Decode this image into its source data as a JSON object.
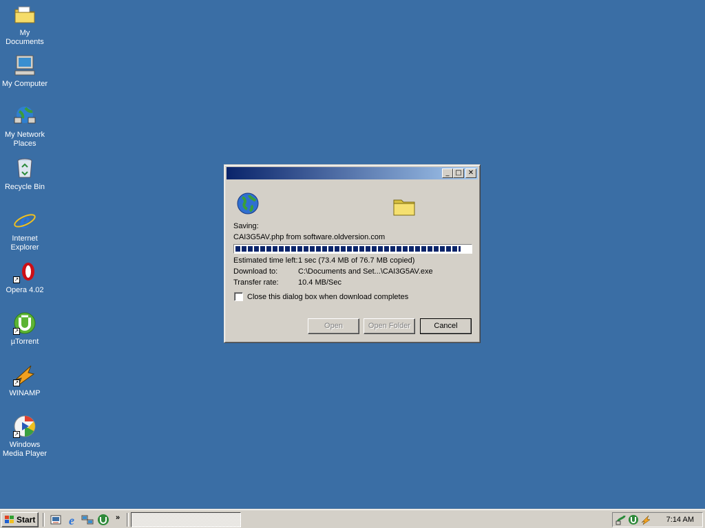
{
  "desktop": {
    "icons": [
      {
        "label": "My Documents",
        "icon": "my-documents-folder-icon"
      },
      {
        "label": "My Computer",
        "icon": "my-computer-icon"
      },
      {
        "label": "My Network Places",
        "icon": "network-places-icon"
      },
      {
        "label": "Recycle Bin",
        "icon": "recycle-bin-icon"
      },
      {
        "label": "Internet Explorer",
        "icon": "internet-explorer-icon"
      },
      {
        "label": "Opera 4.02",
        "icon": "opera-icon"
      },
      {
        "label": "µTorrent",
        "icon": "utorrent-icon"
      },
      {
        "label": "WINAMP",
        "icon": "winamp-icon"
      },
      {
        "label": "Windows Media Player",
        "icon": "media-player-icon"
      }
    ]
  },
  "dialog": {
    "title": "",
    "saving_label": "Saving:",
    "filename": "CAI3G5AV.php from software.oldversion.com",
    "progress": 0.96,
    "estimated_label": "Estimated time left:",
    "estimated_value": "1 sec (73.4 MB of 76.7 MB copied)",
    "download_label": "Download to:",
    "download_value": "C:\\Documents and Set...\\CAI3G5AV.exe",
    "rate_label": "Transfer rate:",
    "rate_value": "10.4 MB/Sec",
    "close_checkbox_label": "Close this dialog box when download completes",
    "close_checkbox_checked": false,
    "buttons": {
      "open": "Open",
      "open_folder": "Open Folder",
      "cancel": "Cancel"
    }
  },
  "taskbar": {
    "start_label": "Start",
    "quick_launch": [
      "show-desktop-icon",
      "internet-explorer-icon",
      "network-icon",
      "utorrent-icon"
    ],
    "chevron": "»",
    "clock": "7:14 AM"
  },
  "colors": {
    "desktop": "#3a6ea5",
    "title_active_start": "#0a246a",
    "title_active_end": "#a6caf0",
    "face": "#d4d0c8",
    "progress": "#0a246a"
  }
}
